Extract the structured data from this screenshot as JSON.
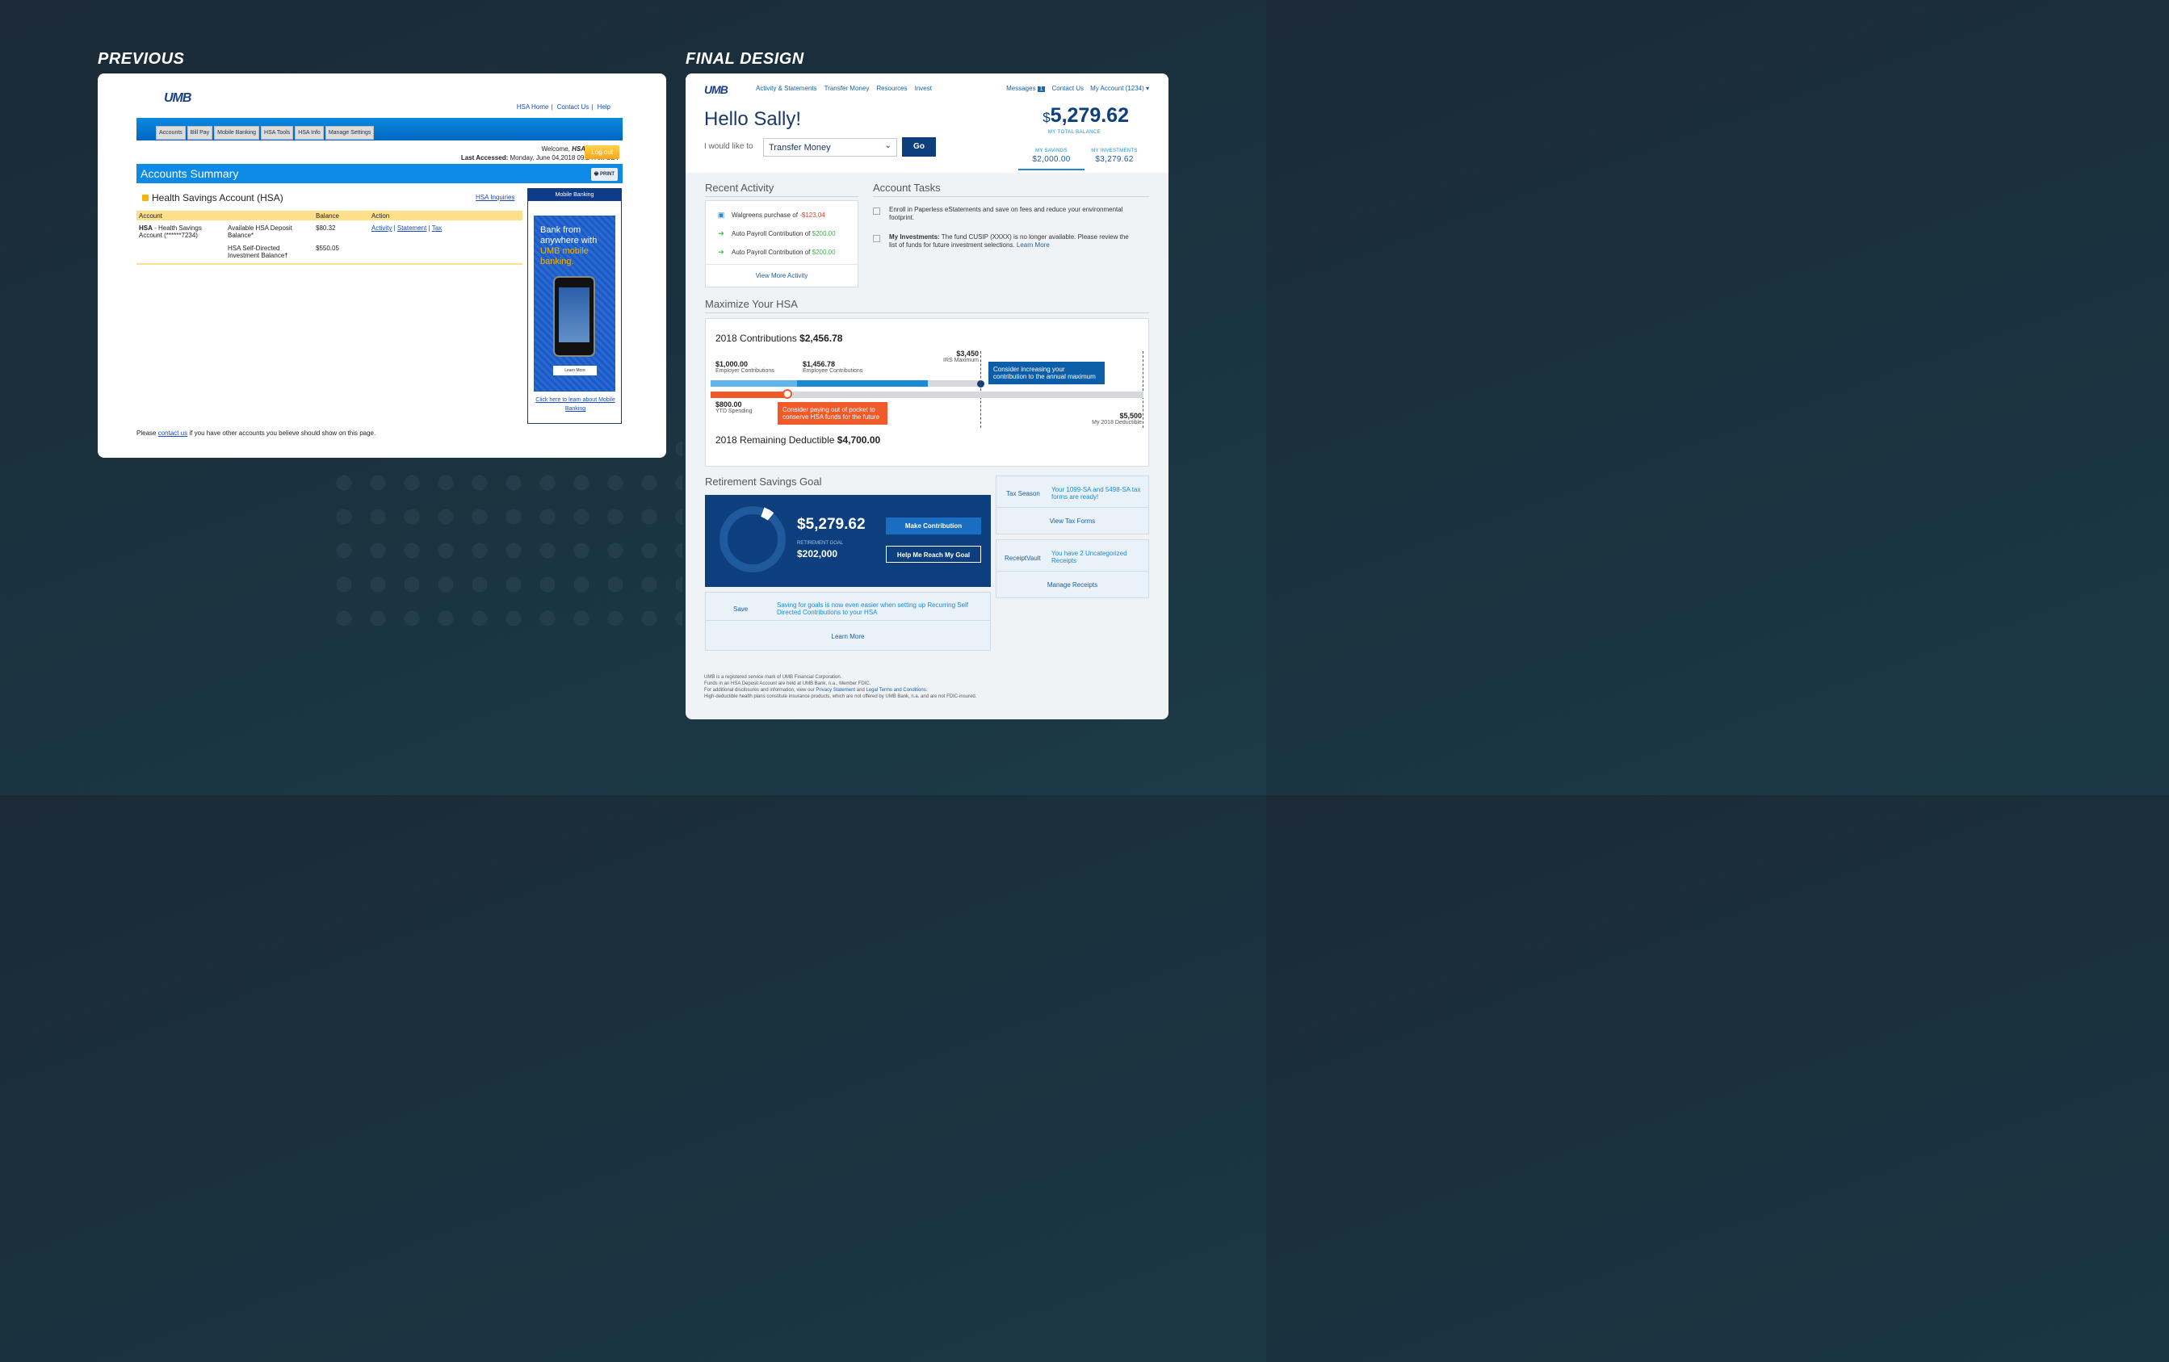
{
  "labels": {
    "previous": "PREVIOUS",
    "final": "FINAL DESIGN"
  },
  "old": {
    "logo": "UMB",
    "toplinks": [
      "HSA Home",
      "Contact Us",
      "Help"
    ],
    "tabs": [
      "Accounts",
      "Bill Pay",
      "Mobile Banking",
      "HSA Tools",
      "HSA Info",
      "Manage Settings"
    ],
    "welcome": "Welcome,",
    "welcome_name": "HSA",
    "last_accessed_label": "Last Accessed:",
    "last_accessed": "Monday, June 04,2018 09:24 AM CDT",
    "logout": "Log out",
    "heading": "Accounts Summary",
    "print": "PRINT",
    "hsa_title": "Health Savings Account (HSA)",
    "hsa_inquiries": "HSA Inquiries",
    "columns": [
      "Account",
      "Balance",
      "Action"
    ],
    "account_name": "HSA",
    "account_desc": "- Health Savings Account (******7234)",
    "rows": [
      {
        "label": "Available HSA Deposit Balance*",
        "balance": "$80.32"
      },
      {
        "label": "HSA Self-Directed Investment Balance†",
        "balance": "$550.05"
      }
    ],
    "actions": [
      "Activity",
      "Statement",
      "Tax"
    ],
    "mobile_head": "Mobile Banking",
    "ad_line1": "Bank from anywhere with",
    "ad_line2": "UMB mobile banking.",
    "ad_learn": "Learn More",
    "mobile_link": "Click here to learn about Mobile Banking",
    "footer_pre": "Please",
    "footer_link": "contact us",
    "footer_post": "if you have other accounts you believe should show on this page."
  },
  "new": {
    "logo": "UMB",
    "nav": [
      "Activity & Statements",
      "Transfer Money",
      "Resources",
      "Invest"
    ],
    "messages": "Messages",
    "messages_count": "1",
    "contact": "Contact Us",
    "account": "My Account (1234) ▾",
    "hello": "Hello Sally!",
    "would_like": "I would like to",
    "select_value": "Transfer Money",
    "go": "Go",
    "total_cur": "$",
    "total": "5,279.62",
    "total_label": "MY TOTAL BALANCE",
    "savings_label": "MY SAVINGS",
    "savings": "$2,000.00",
    "invest_label": "MY INVESTMENTS",
    "invest": "$3,279.62",
    "recent_title": "Recent Activity",
    "recent": [
      {
        "text": "Walgreens purchase of",
        "amount": "-$123.04",
        "icon": "receipt-icon"
      },
      {
        "text": "Auto Payroll Contribution of",
        "amount": "$200.00",
        "icon": "arrow-right-icon"
      },
      {
        "text": "Auto Payroll Contribution of",
        "amount": "$200.00",
        "icon": "arrow-right-icon"
      }
    ],
    "view_more": "View More Activity",
    "tasks_title": "Account Tasks",
    "task1": "Enroll in Paperless eStatements and save on fees and reduce your environmental footprint.",
    "task2_label": "My Investments:",
    "task2": "The fund CUSIP (XXXX) is no longer available. Please review the list of funds for future investment selections.",
    "task2_link": "Learn More",
    "max_title": "Maximize Your HSA",
    "contrib_label": "2018 Contributions",
    "contrib": "$2,456.78",
    "employer_amt": "$1,000.00",
    "employer_label": "Employer Contributions",
    "employee_amt": "$1,456.78",
    "employee_label": "Employee Contributions",
    "irs_amt": "$3,450",
    "irs_label": "IRS Maximum",
    "callout_blue": "Consider increasing your contribution to the annual maximum",
    "ytd_amt": "$800.00",
    "ytd_label": "YTD Spending",
    "callout_red": "Consider paying out of pocket to conserve HSA funds for the future",
    "deduct_amt": "$5,500",
    "deduct_label": "My 2018 Deductible",
    "remaining_label": "2018 Remaining Deductible",
    "remaining": "$4,700.00",
    "ret_title": "Retirement Savings Goal",
    "ret_amount": "$5,279.62",
    "ret_goal_label": "RETIREMENT GOAL",
    "ret_goal": "$202,000",
    "make_contrib": "Make Contribution",
    "help_goal": "Help Me Reach My Goal",
    "ret_progress": 0.026,
    "save_label": "Save",
    "save_text": "Saving for goals is now even easier when setting up Recurring Self Directed Contributions to your HSA",
    "save_link": "Learn More",
    "tax_label": "Tax Season",
    "tax_text": "Your 1099-SA and 5498-SA tax forms are ready!",
    "tax_link": "View Tax Forms",
    "receipt_label": "ReceiptVault",
    "receipt_text": "You have 2 Uncategorized Receipts",
    "receipt_link": "Manage Receipts",
    "foot1": "UMB is a registered service mark of UMB Financial Corporation.",
    "foot2": "Funds in an HSA Deposit Account are held at UMB Bank, n.a., Member FDIC.",
    "foot3a": "For additional disclosures and information, view our",
    "foot3b": "Privacy Statement",
    "foot3c": "and",
    "foot3d": "Legal Terms and Conditions.",
    "foot4": "High-deductible health plans constitute insurance products, which are not offered by UMB Bank, n.a. and are not FDIC-insured.",
    "colors": {
      "navy": "#0d3f7e",
      "blue": "#1a8ad6",
      "red": "#f05a28",
      "green": "#3cb64a"
    }
  }
}
